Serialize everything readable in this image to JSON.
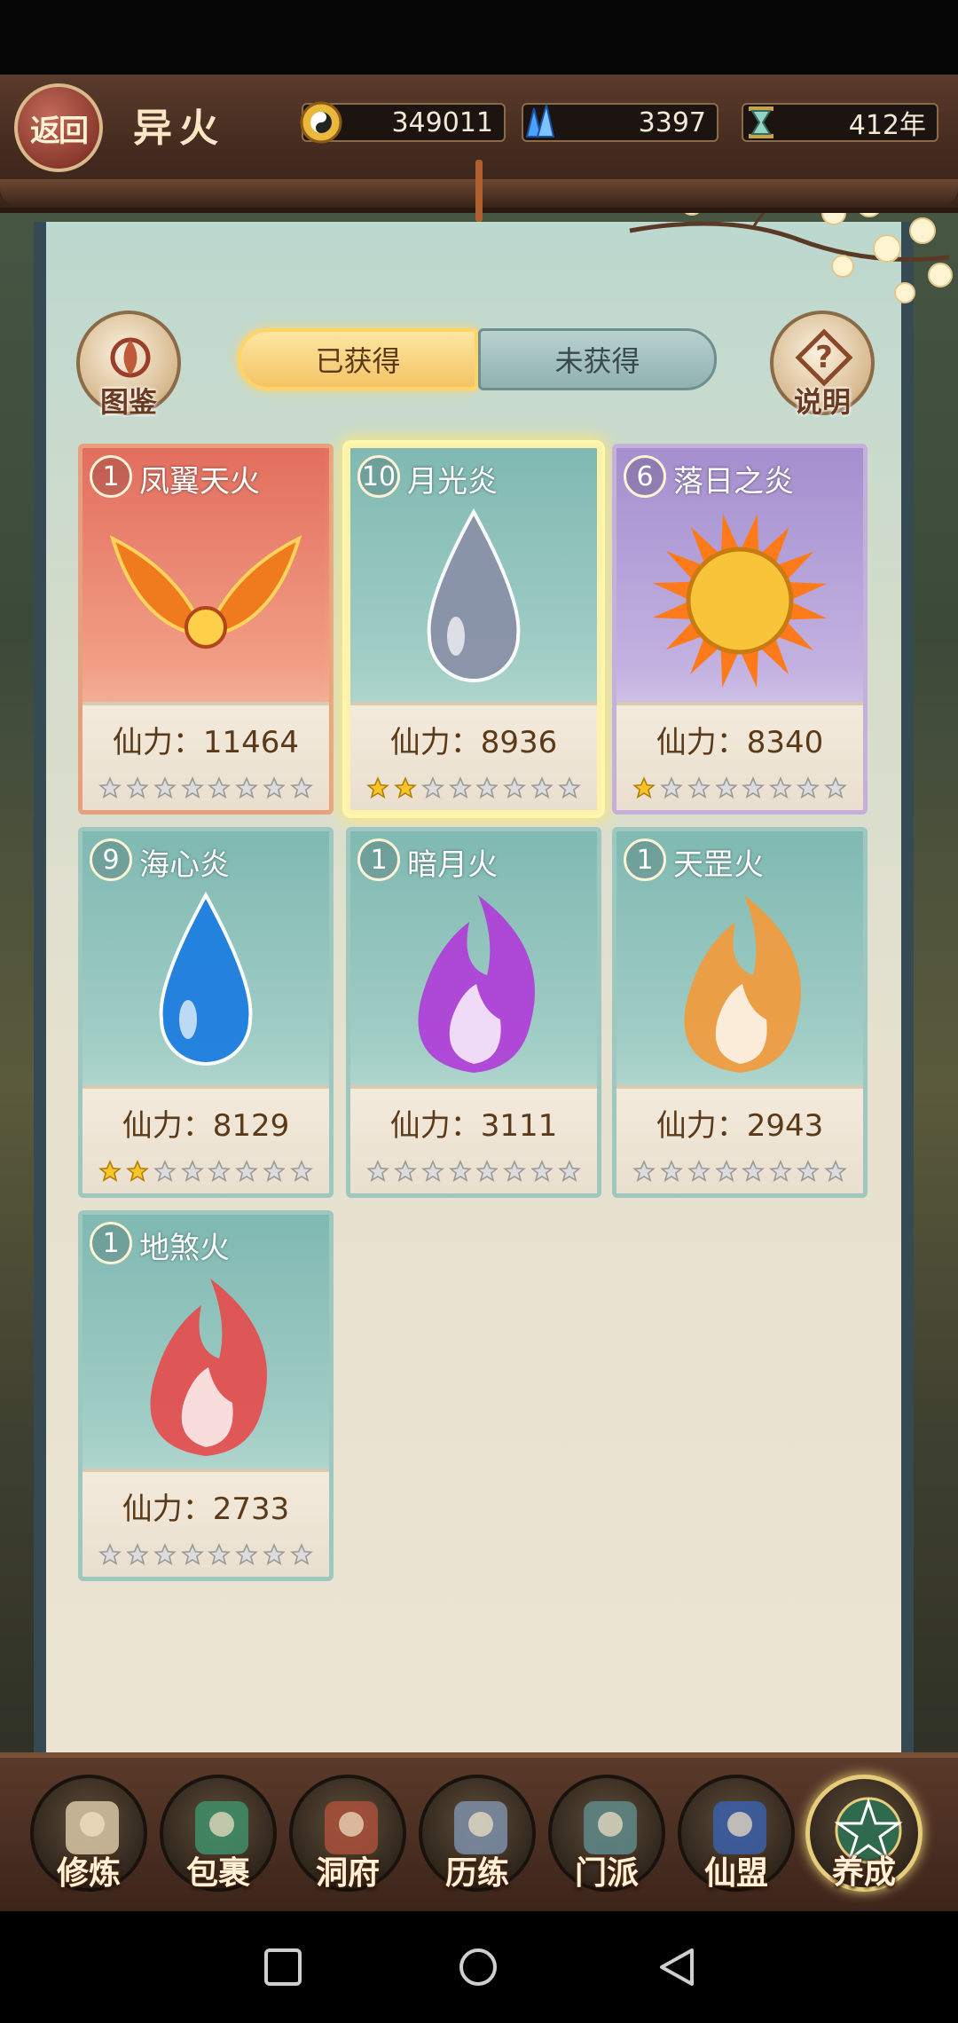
{
  "header": {
    "back_label": "返回",
    "title": "异火",
    "resources": [
      {
        "icon": "yin-yang-coin-icon",
        "value": "349011"
      },
      {
        "icon": "blue-crystal-icon",
        "value": "3397"
      },
      {
        "icon": "hourglass-icon",
        "value": "412年"
      }
    ]
  },
  "side_buttons": {
    "codex_label": "图鉴",
    "help_label": "说明"
  },
  "tabs": [
    {
      "label": "已获得",
      "active": true
    },
    {
      "label": "未获得",
      "active": false
    }
  ],
  "power_prefix": "仙力：",
  "cards": [
    {
      "level": "1",
      "name": "凤翼天火",
      "power": "11464",
      "stars": 0,
      "theme": "red",
      "art": "phoenix-wings-flame"
    },
    {
      "level": "10",
      "name": "月光炎",
      "power": "8936",
      "stars": 2,
      "theme": "teal",
      "art": "silver-drop-flame",
      "selected": true
    },
    {
      "level": "6",
      "name": "落日之炎",
      "power": "8340",
      "stars": 1,
      "theme": "purple",
      "art": "sun-flame"
    },
    {
      "level": "9",
      "name": "海心炎",
      "power": "8129",
      "stars": 2,
      "theme": "teal",
      "art": "blue-drop-flame"
    },
    {
      "level": "1",
      "name": "暗月火",
      "power": "3111",
      "stars": 0,
      "theme": "teal",
      "art": "purple-flame"
    },
    {
      "level": "1",
      "name": "天罡火",
      "power": "2943",
      "stars": 0,
      "theme": "teal",
      "art": "orange-flame"
    },
    {
      "level": "1",
      "name": "地煞火",
      "power": "2733",
      "stars": 0,
      "theme": "teal",
      "art": "red-flame"
    }
  ],
  "max_stars": 8,
  "colors": {
    "red-flame": "#e64a4a",
    "orange-flame": "#f39a3a",
    "purple-flame": "#b03ad8",
    "blue-drop-flame": "#1e7fe0",
    "silver-drop-flame": "#8a92a8",
    "sun-flame": "#f2a81e",
    "phoenix-wings-flame": "#f07a1e"
  },
  "bottom_nav": [
    {
      "label": "修炼",
      "icon": "cultivator-avatar-icon",
      "active": false
    },
    {
      "label": "包裹",
      "icon": "bag-icon",
      "active": false
    },
    {
      "label": "洞府",
      "icon": "cave-dwelling-icon",
      "active": false
    },
    {
      "label": "历练",
      "icon": "scroll-icon",
      "active": false
    },
    {
      "label": "门派",
      "icon": "sect-gate-icon",
      "active": false
    },
    {
      "label": "仙盟",
      "icon": "alliance-crown-icon",
      "active": false
    },
    {
      "label": "养成",
      "icon": "pentagram-icon",
      "active": true
    }
  ],
  "system_nav": [
    "recent-apps-icon",
    "home-icon",
    "back-triangle-icon"
  ]
}
